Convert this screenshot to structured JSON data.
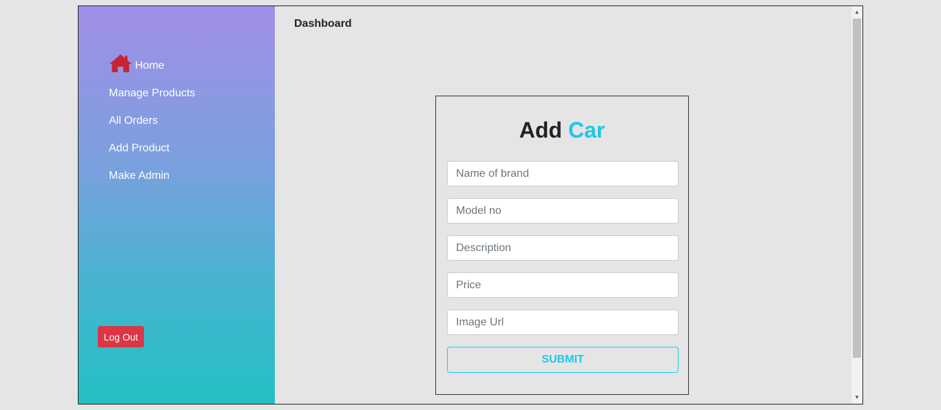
{
  "sidebar": {
    "items": [
      {
        "label": "Home",
        "icon": "home-icon"
      },
      {
        "label": "Manage Products"
      },
      {
        "label": "All Orders"
      },
      {
        "label": "Add Product"
      },
      {
        "label": "Make Admin"
      }
    ],
    "logout_label": "Log Out"
  },
  "header": {
    "title": "Dashboard"
  },
  "form": {
    "title_main": "Add",
    "title_accent": "Car",
    "fields": [
      {
        "placeholder": "Name of brand",
        "value": ""
      },
      {
        "placeholder": "Model no",
        "value": ""
      },
      {
        "placeholder": "Description",
        "value": ""
      },
      {
        "placeholder": "Price",
        "value": ""
      },
      {
        "placeholder": "Image Url",
        "value": ""
      }
    ],
    "submit_label": "SUBMIT"
  },
  "colors": {
    "accent": "#1ec8e8",
    "danger": "#dc3545",
    "home_icon": "#c82333",
    "sidebar_gradient_top": "#a18ee8",
    "sidebar_gradient_bottom": "#22c1c3"
  }
}
